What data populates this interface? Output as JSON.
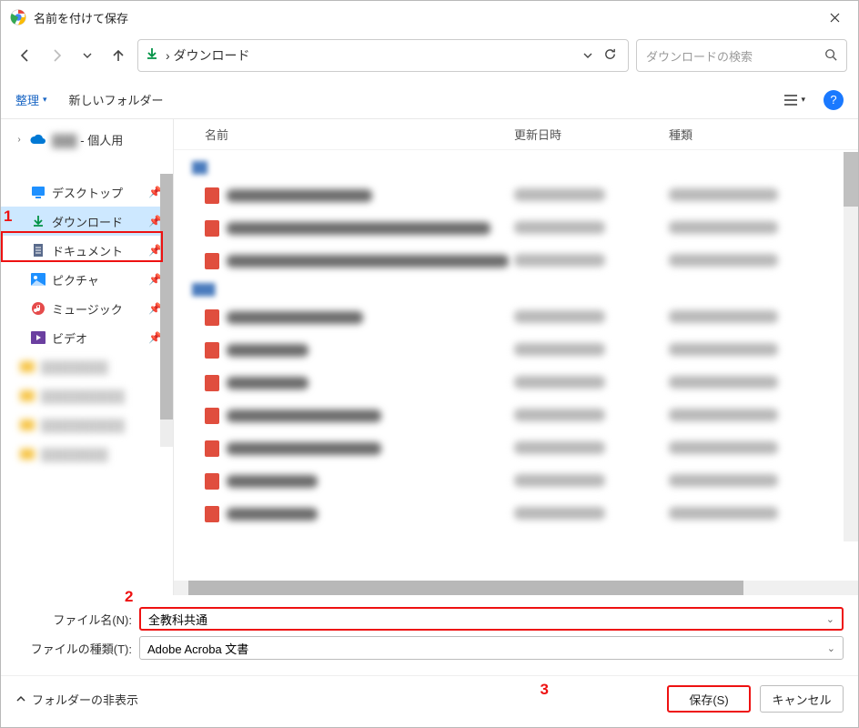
{
  "title": "名前を付けて保存",
  "breadcrumb": "› ダウンロード",
  "search_placeholder": "ダウンロードの検索",
  "toolbar": {
    "organize": "整理",
    "new_folder": "新しいフォルダー"
  },
  "tree": {
    "personal_suffix": "- 個人用",
    "items": [
      {
        "label": "デスクトップ"
      },
      {
        "label": "ダウンロード"
      },
      {
        "label": "ドキュメント"
      },
      {
        "label": "ピクチャ"
      },
      {
        "label": "ミュージック"
      },
      {
        "label": "ビデオ"
      }
    ]
  },
  "list": {
    "col1": "名前",
    "col2": "更新日時",
    "col3": "種類"
  },
  "form": {
    "filename_label": "ファイル名(N):",
    "filename_value": "全教科共通",
    "filetype_label": "ファイルの種類(T):",
    "filetype_value": "Adobe Acroba 文書"
  },
  "footer": {
    "hide": "フォルダーの非表示",
    "save": "保存(S)",
    "cancel": "キャンセル"
  },
  "markers": {
    "m1": "1",
    "m2": "2",
    "m3": "3"
  }
}
